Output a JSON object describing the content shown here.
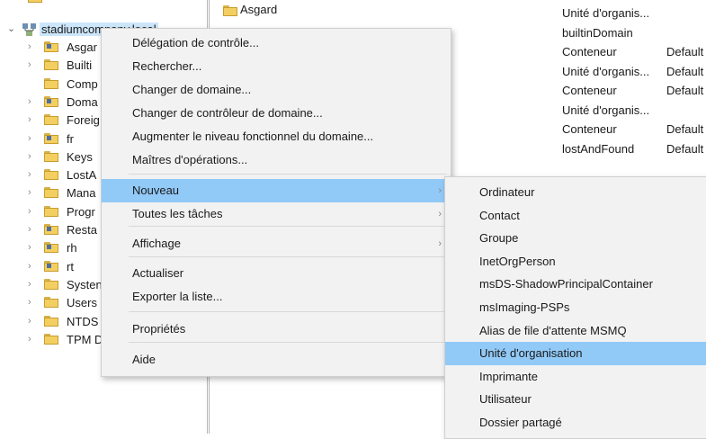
{
  "tree": {
    "root_label": "stadiumcompany.local",
    "items": [
      {
        "label": "Asgar",
        "ou": true
      },
      {
        "label": "Builti",
        "ou": false
      },
      {
        "label": "Comp",
        "ou": false
      },
      {
        "label": "Doma",
        "ou": true
      },
      {
        "label": "Foreig",
        "ou": false
      },
      {
        "label": "fr",
        "ou": true
      },
      {
        "label": "Keys",
        "ou": false
      },
      {
        "label": "LostA",
        "ou": false
      },
      {
        "label": "Mana",
        "ou": false
      },
      {
        "label": "Progr",
        "ou": false
      },
      {
        "label": "Resta",
        "ou": true
      },
      {
        "label": "rh",
        "ou": true
      },
      {
        "label": "rt",
        "ou": true
      },
      {
        "label": "Systen",
        "ou": false
      },
      {
        "label": "Users",
        "ou": false
      },
      {
        "label": "NTDS",
        "ou": false
      },
      {
        "label": "TPM D",
        "ou": false
      }
    ]
  },
  "list": {
    "top_name": "Asgard",
    "rows": [
      {
        "type": "Unité d'organis...",
        "desc": ""
      },
      {
        "type": "builtinDomain",
        "desc": ""
      },
      {
        "type": "Conteneur",
        "desc": "Default"
      },
      {
        "type": "Unité d'organis...",
        "desc": "Default"
      },
      {
        "type": "Conteneur",
        "desc": "Default"
      },
      {
        "type": "Unité d'organis...",
        "desc": ""
      },
      {
        "type": "Conteneur",
        "desc": "Default"
      },
      {
        "type": "lostAndFound",
        "desc": "Default"
      }
    ]
  },
  "context_menu": {
    "items": [
      "Délégation de contrôle...",
      "Rechercher...",
      "Changer de domaine...",
      "Changer de contrôleur de domaine...",
      "Augmenter le niveau fonctionnel du domaine...",
      "Maîtres d'opérations...",
      "Nouveau",
      "Toutes les tâches",
      "Affichage",
      "Actualiser",
      "Exporter la liste...",
      "Propriétés",
      "Aide"
    ],
    "submenu_arrow": "›"
  },
  "submenu": {
    "items": [
      "Ordinateur",
      "Contact",
      "Groupe",
      "InetOrgPerson",
      "msDS-ShadowPrincipalContainer",
      "msImaging-PSPs",
      "Alias de file d'attente MSMQ",
      "Unité d'organisation",
      "Imprimante",
      "Utilisateur",
      "Dossier partagé"
    ]
  },
  "colors": {
    "highlight": "#91c9f7",
    "menu_bg": "#f2f2f2",
    "folder": "#f3cf62"
  },
  "icons": {
    "expand": "chevron-right-icon",
    "collapse": "chevron-down-icon",
    "folder": "folder-icon",
    "domain": "domain-icon"
  }
}
